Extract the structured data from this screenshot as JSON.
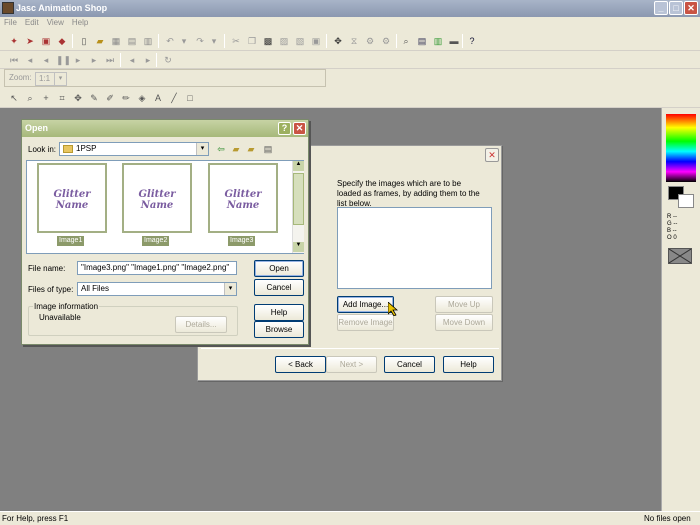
{
  "app": {
    "title": "Jasc Animation Shop"
  },
  "menu": [
    "File",
    "Edit",
    "View",
    "Help"
  ],
  "zoom": {
    "label": "Zoom:",
    "value": "1:1"
  },
  "status": {
    "left": "For Help, press F1",
    "right": "No files open"
  },
  "palette": {
    "r": "R --",
    "g": "G --",
    "b": "B --",
    "o": "O 0"
  },
  "wizard": {
    "instructions": "Specify the images which are to be loaded as frames, by adding them to the list below.",
    "add_image": "Add Image...",
    "remove_image": "Remove Image",
    "move_up": "Move Up",
    "move_down": "Move Down",
    "back": "< Back",
    "next": "Next >",
    "cancel": "Cancel",
    "help": "Help"
  },
  "open": {
    "title": "Open",
    "look_in_label": "Look in:",
    "look_in_value": "1PSP",
    "thumbs": [
      {
        "text": "Glitter Name",
        "caption": "Image1"
      },
      {
        "text": "Glitter Name",
        "caption": "Image2"
      },
      {
        "text": "Glitter Name",
        "caption": "Image3"
      }
    ],
    "file_name_label": "File name:",
    "file_name_value": "\"Image3.png\" \"Image1.png\" \"Image2.png\"",
    "files_of_type_label": "Files of type:",
    "files_of_type_value": "All Files",
    "image_info_label": "Image information",
    "image_info_value": "Unavailable",
    "details": "Details...",
    "open_btn": "Open",
    "cancel_btn": "Cancel",
    "help_btn": "Help",
    "browse_btn": "Browse"
  }
}
